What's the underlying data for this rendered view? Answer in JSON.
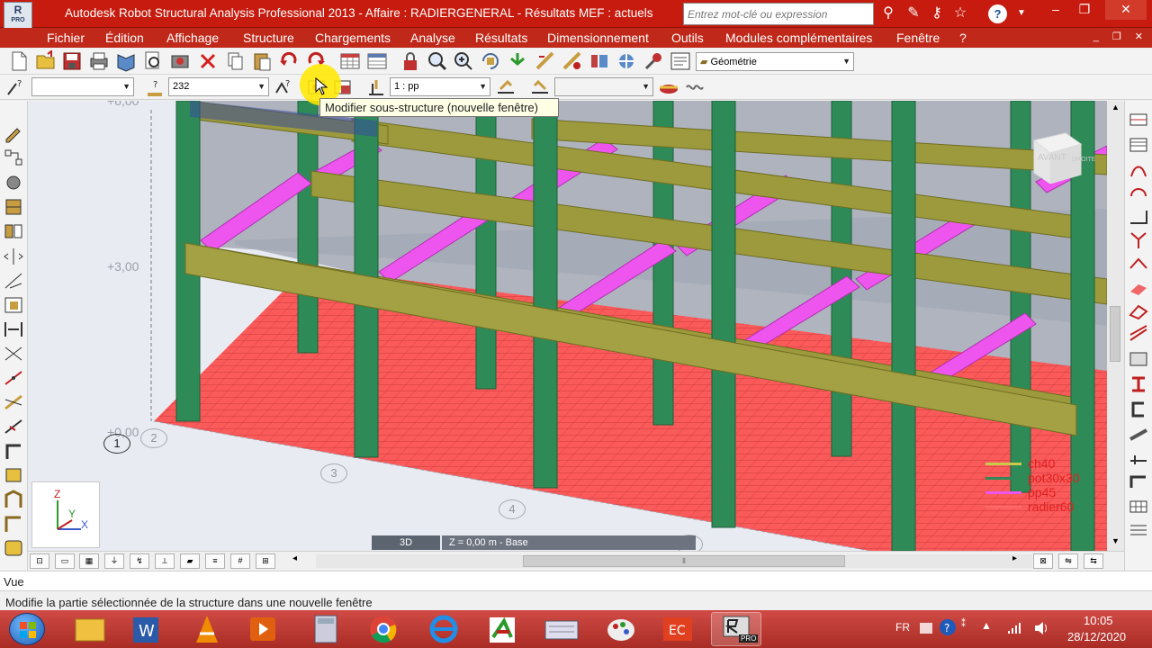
{
  "window": {
    "title": "Autodesk Robot Structural Analysis Professional 2013 - Affaire : RADIERGENERAL - Résultats MEF : actuels",
    "app_icon_label": "R",
    "app_icon_sub": "PRO",
    "search_placeholder": "Entrez mot-clé ou expression",
    "help_label": "?",
    "minimize": "–",
    "maximize": "❐",
    "close": "✕"
  },
  "menu": {
    "items": [
      "Fichier",
      "Édition",
      "Affichage",
      "Structure",
      "Chargements",
      "Analyse",
      "Résultats",
      "Dimensionnement",
      "Outils",
      "Modules complémentaires",
      "Fenêtre",
      "?"
    ],
    "mdi_controls": "_ ❐ ✕"
  },
  "toolbar": {
    "view_mode": "Géométrie",
    "selection_value": "",
    "bar_number": "232",
    "load_case": "1 : pp",
    "extra_select": ""
  },
  "tooltip": "Modifier sous-structure (nouvelle fenêtre)",
  "viewport": {
    "level_labels": [
      "+6,00",
      "+3,00",
      "+0,00"
    ],
    "axis_labels": [
      "1",
      "2",
      "3",
      "4",
      "5"
    ],
    "axis_gizmo": {
      "z": "Z",
      "y": "Y",
      "x": "X"
    },
    "view_cube_label": "AVANT",
    "view_cube_side": "DROITE",
    "view_tag": "3D",
    "plane_tag": "Z = 0,00 m - Base",
    "legend": [
      {
        "label": "ch40",
        "color": "#c9c94a"
      },
      {
        "label": "pot30x30",
        "color": "#2e8b57"
      },
      {
        "label": "pp45",
        "color": "#ee55ee"
      },
      {
        "label": "radier60",
        "color": "#ff6666"
      }
    ]
  },
  "bottom": {
    "vue_label": "Vue",
    "status": "Modifie la partie sélectionnée de la structure dans une nouvelle fenêtre"
  },
  "taskbar": {
    "language": "FR",
    "time": "10:05",
    "date": "28/12/2020",
    "active_app_badge": "PRO"
  },
  "colors": {
    "titlebar": "#c61b0e",
    "menubar": "#c0281a",
    "slab_mesh": "#fb5a5a",
    "column": "#2e8b57",
    "beam": "#9c9a3c",
    "secondary_beam": "#ee55ee",
    "floor": "#a7acb7"
  }
}
